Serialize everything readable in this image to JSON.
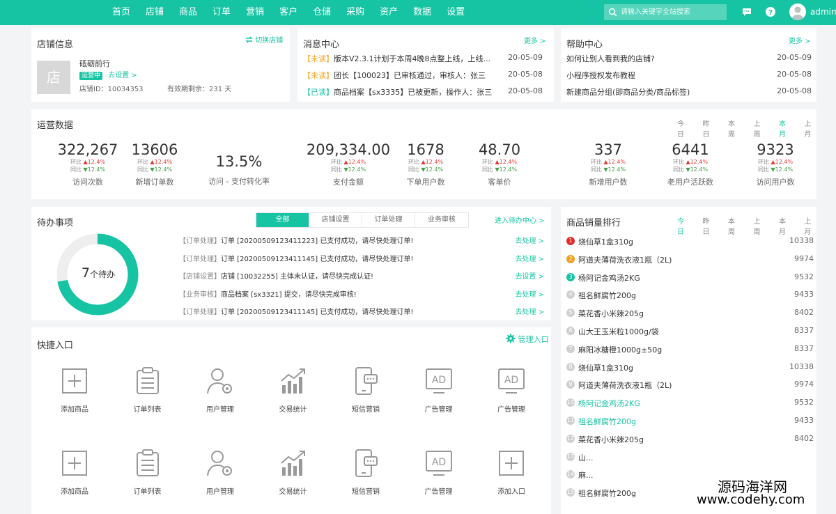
{
  "nav": [
    "首页",
    "店铺",
    "商品",
    "订单",
    "营销",
    "客户",
    "仓储",
    "采购",
    "资产",
    "数据",
    "设置"
  ],
  "search_placeholder": "请输入关键字全站搜索",
  "user": "admin",
  "store": {
    "title": "店铺信息",
    "switch": "切换店铺",
    "logo": "店",
    "name": "砥砺前行",
    "status": "运营中",
    "setup": "去设置 >",
    "id": "店铺ID：10034353",
    "expire": "有效期剩余：231 天"
  },
  "messages": {
    "title": "消息中心",
    "more": "更多 >",
    "items": [
      {
        "tag": "【未读】",
        "text": "版本V2.3.1计划于本周4晚8点整上线，上线...",
        "date": "20-05-09"
      },
      {
        "tag": "【未读】",
        "text": "团长【100023】已审核通过，审核人：张三",
        "date": "20-05-08"
      },
      {
        "tag": "【已读】",
        "text": "商品档案【sx3335】已被更新，操作人：张三",
        "date": "20-05-08"
      }
    ]
  },
  "help": {
    "title": "帮助中心",
    "more": "更多 >",
    "items": [
      {
        "text": "如何让别人看到我的店铺?",
        "date": "20-05-09"
      },
      {
        "text": "小程序授权发布教程",
        "date": "20-05-08"
      },
      {
        "text": "新建商品分组(即商品分类/商品标签)",
        "date": "20-05-08"
      }
    ]
  },
  "ops": {
    "title": "运营数据",
    "periods": [
      "今日",
      "昨日",
      "本周",
      "上周",
      "本月",
      "上月"
    ],
    "active_period": "本月",
    "yoy_label": "环比",
    "mom_label": "同比",
    "change": "12.4%",
    "stats": [
      {
        "value": "322,267",
        "label": "访问次数",
        "has_cmp": true
      },
      {
        "value": "13606",
        "label": "新增订单数",
        "has_cmp": true
      },
      {
        "value": "13.5%",
        "label": "访问 - 支付转化率",
        "has_cmp": false
      },
      {
        "value": "209,334.00",
        "label": "支付金额",
        "has_cmp": true
      },
      {
        "value": "1678",
        "label": "下单用户数",
        "has_cmp": true
      },
      {
        "value": "48.70",
        "label": "客单价",
        "has_cmp": true
      },
      {
        "value": "337",
        "label": "新增用户数",
        "has_cmp": true
      },
      {
        "value": "6441",
        "label": "老用户活跃数",
        "has_cmp": true
      },
      {
        "value": "9323",
        "label": "访问用户数",
        "has_cmp": true
      }
    ]
  },
  "todo": {
    "title": "待办事项",
    "tabs": [
      "全部",
      "店铺设置",
      "订单处理",
      "业务审核"
    ],
    "active_tab": "全部",
    "center": "进入待办中心 >",
    "count": "7",
    "count_suffix": "个待办",
    "ring_fraction": 0.72,
    "items": [
      {
        "cat": "【订单处理】",
        "text": "订单 [20200509123411223] 已支付成功，请尽快处理订单!",
        "action": "去处理 >"
      },
      {
        "cat": "【订单处理】",
        "text": "订单 [20200509123411145] 已支付成功，请尽快处理订单!",
        "action": "去处理 >"
      },
      {
        "cat": "【店铺设置】",
        "text": "店铺 [10032255] 主体未认证，请尽快完成认证!",
        "action": "去设置 >"
      },
      {
        "cat": "【业务审核】",
        "text": "商品档案 [sx3321] 提交，请尽快完成审核!",
        "action": "去处理 >"
      },
      {
        "cat": "【订单处理】",
        "text": "订单 [20200509123411145] 已支付成功，请尽快处理订单!",
        "action": "去处理 >"
      }
    ]
  },
  "quick": {
    "title": "快捷入口",
    "manage": "管理入口",
    "rows": [
      [
        {
          "icon": "plus-box-icon",
          "label": "添加商品"
        },
        {
          "icon": "clipboard-list-icon",
          "label": "订单列表"
        },
        {
          "icon": "user-gear-icon",
          "label": "用户管理"
        },
        {
          "icon": "bar-chart-icon",
          "label": "交易统计"
        },
        {
          "icon": "phone-message-icon",
          "label": "短信营销"
        },
        {
          "icon": "ad-monitor-icon",
          "label": "广告管理"
        },
        {
          "icon": "ad-monitor-icon",
          "label": "广告管理"
        }
      ],
      [
        {
          "icon": "plus-box-icon",
          "label": "添加商品"
        },
        {
          "icon": "clipboard-list-icon",
          "label": "订单列表"
        },
        {
          "icon": "user-gear-icon",
          "label": "用户管理"
        },
        {
          "icon": "bar-chart-icon",
          "label": "交易统计"
        },
        {
          "icon": "phone-message-icon",
          "label": "短信营销"
        },
        {
          "icon": "ad-monitor-icon",
          "label": "广告管理"
        },
        {
          "icon": "plus-box-icon",
          "label": "添加入口"
        }
      ]
    ]
  },
  "ranking": {
    "title": "商品销量排行",
    "periods": [
      "今日",
      "昨日",
      "本周",
      "上周",
      "本月",
      "上月"
    ],
    "active_period": "今日",
    "colors": {
      "1": "#e02b2b",
      "2": "#f0a020",
      "3": "#16c4a3",
      "other": "#cfcfcf"
    },
    "items": [
      {
        "rank": "1",
        "name": "烧仙草1盒310g",
        "value": "10338",
        "highlight": false
      },
      {
        "rank": "2",
        "name": "阿道夫薄荷洗衣液1瓶（2L)",
        "value": "9974",
        "highlight": false
      },
      {
        "rank": "3",
        "name": "杨阿记金鸡汤2KG",
        "value": "9532",
        "highlight": false
      },
      {
        "rank": "4",
        "name": "祖名鲜腐竹200g",
        "value": "9433",
        "highlight": false
      },
      {
        "rank": "5",
        "name": "菜花香小米辣205g",
        "value": "8402",
        "highlight": false
      },
      {
        "rank": "6",
        "name": "山大王玉米粒1000g/袋",
        "value": "8337",
        "highlight": false
      },
      {
        "rank": "7",
        "name": "麻阳冰糖橙1000g±50g",
        "value": "8337",
        "highlight": false
      },
      {
        "rank": "8",
        "name": "烧仙草1盒310g",
        "value": "10338",
        "highlight": false
      },
      {
        "rank": "9",
        "name": "阿道夫薄荷洗衣液1瓶（2L)",
        "value": "9974",
        "highlight": false
      },
      {
        "rank": "10",
        "name": "杨阿记金鸡汤2KG",
        "value": "9532",
        "highlight": true
      },
      {
        "rank": "11",
        "name": "祖名鲜腐竹200g",
        "value": "9433",
        "highlight": true
      },
      {
        "rank": "12",
        "name": "菜花香小米辣205g",
        "value": "8402",
        "highlight": false
      },
      {
        "rank": "13",
        "name": "山...",
        "value": "",
        "highlight": false
      },
      {
        "rank": "14",
        "name": "麻...",
        "value": "",
        "highlight": false
      },
      {
        "rank": "15",
        "name": "祖名鲜腐竹200g",
        "value": "",
        "highlight": false
      }
    ]
  },
  "watermark": {
    "line1": "源码海洋网",
    "line2": "www.codehy.com"
  }
}
